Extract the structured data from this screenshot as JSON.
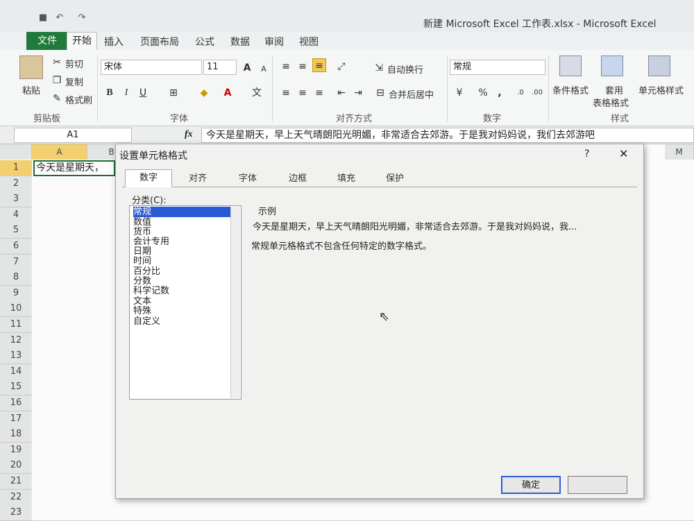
{
  "window": {
    "title": "新建 Microsoft Excel 工作表.xlsx - Microsoft Excel"
  },
  "tabs": [
    "文件",
    "开始",
    "插入",
    "页面布局",
    "公式",
    "数据",
    "审阅",
    "视图"
  ],
  "ribbon": {
    "clipboard": {
      "paste": "粘贴",
      "cut": "剪切",
      "copy": "复制",
      "format_painter": "格式刷",
      "group": "剪贴板"
    },
    "font": {
      "name": "宋体",
      "size": "11",
      "bold": "B",
      "italic": "I",
      "underline": "U",
      "group": "字体"
    },
    "alignment": {
      "wrap": "自动换行",
      "merge": "合并后居中",
      "group": "对齐方式"
    },
    "number": {
      "format": "常规",
      "percent": "%",
      "comma": ",",
      "group": "数字"
    },
    "styles": {
      "conditional": "条件格式",
      "table_1": "套用",
      "table_2": "表格格式",
      "cell_styles": "单元格样式",
      "group": "样式"
    }
  },
  "formula_bar": {
    "cell_ref": "A1",
    "fx": "fx",
    "content": "今天是星期天，早上天气晴朗阳光明媚，非常适合去郊游。于是我对妈妈说，我们去郊游吧"
  },
  "sheet": {
    "columns": [
      "A",
      "B",
      "M"
    ],
    "rows": [
      "1",
      "2",
      "3",
      "4",
      "5",
      "6",
      "7",
      "8",
      "9",
      "10",
      "11",
      "12",
      "13",
      "14",
      "15",
      "16",
      "17",
      "18",
      "19",
      "20",
      "21",
      "22",
      "23"
    ],
    "a1_text": "今天是星期天，"
  },
  "dialog": {
    "title": "设置单元格格式",
    "help": "?",
    "close": "✕",
    "tabs": [
      "数字",
      "对齐",
      "字体",
      "边框",
      "填充",
      "保护"
    ],
    "category_label": "分类(C):",
    "categories": [
      "常规",
      "数值",
      "货币",
      "会计专用",
      "日期",
      "时间",
      "百分比",
      "分数",
      "科学记数",
      "文本",
      "特殊",
      "自定义"
    ],
    "sample_label": "示例",
    "sample_value": "今天是星期天，早上天气晴朗阳光明媚，非常适合去郊游。于是我对妈妈说，我...",
    "description": "常规单元格格式不包含任何特定的数字格式。",
    "ok": "确定"
  },
  "colors": {
    "file_tab": "#1f7a3b",
    "selection": "#2a5bd7"
  }
}
